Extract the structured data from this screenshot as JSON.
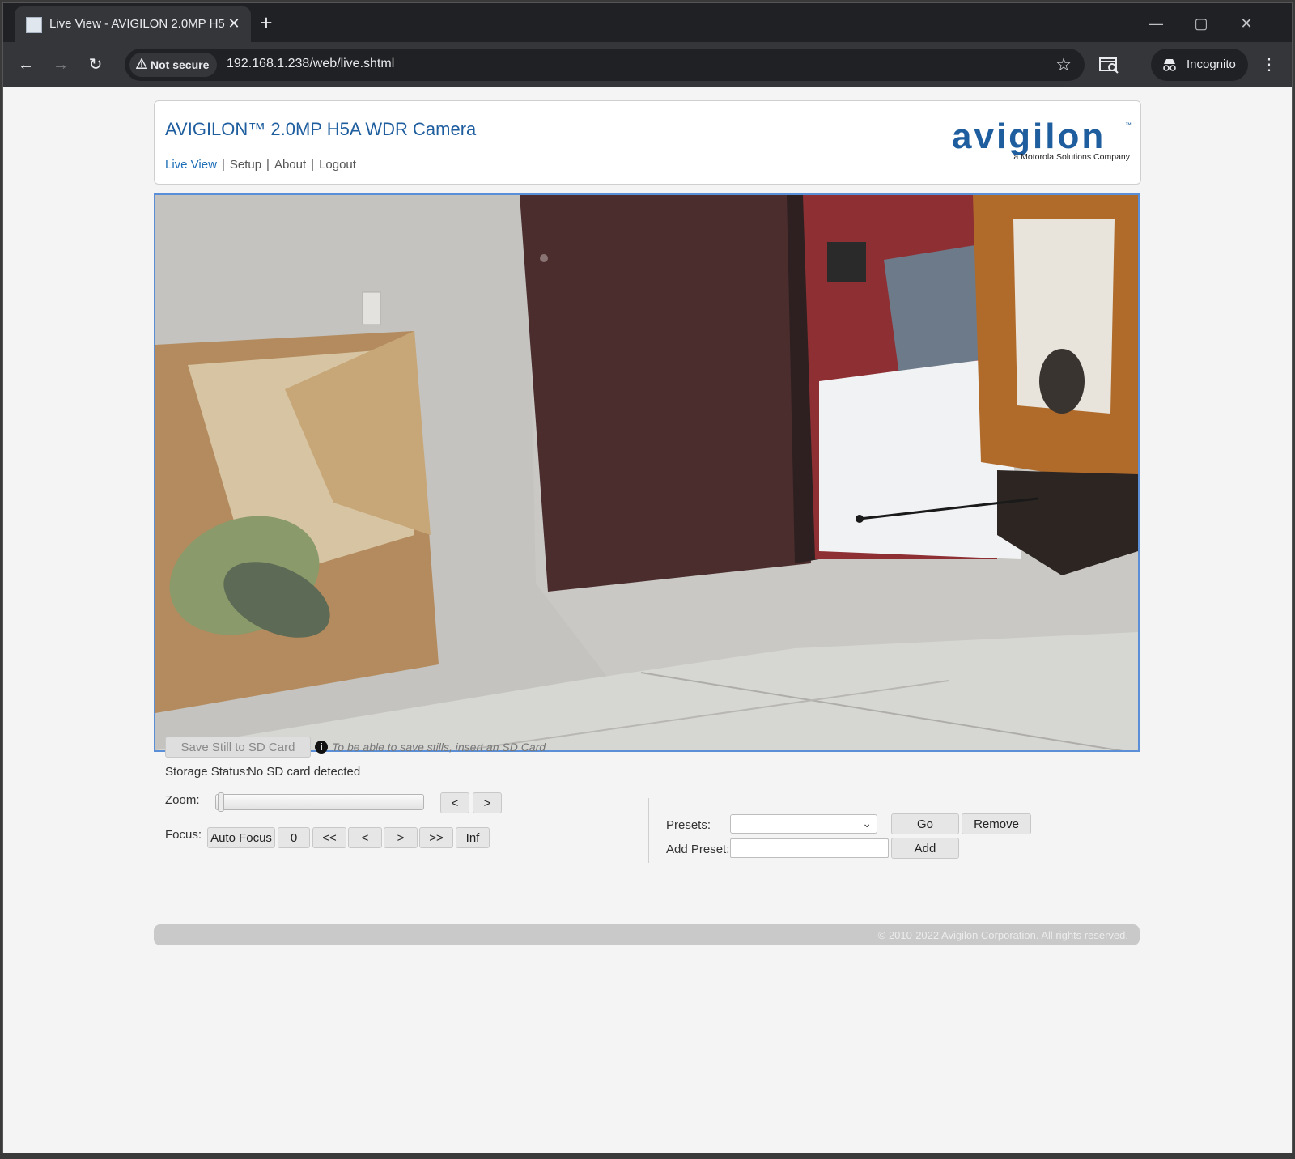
{
  "browser": {
    "tab_title": "Live View - AVIGILON 2.0MP H5",
    "security_label": "Not secure",
    "url": "192.168.1.238/web/live.shtml",
    "profile_label": "Incognito"
  },
  "header": {
    "camera_title": "AVIGILON™ 2.0MP H5A WDR Camera",
    "nav": [
      {
        "label": "Live View",
        "active": true
      },
      {
        "label": "Setup",
        "active": false
      },
      {
        "label": "About",
        "active": false
      },
      {
        "label": "Logout",
        "active": false
      }
    ],
    "logo_text": "avigilon",
    "logo_tm": "™",
    "logo_tagline": "a Motorola Solutions Company"
  },
  "storage": {
    "save_still_label": "Save Still to SD Card",
    "hint": "To be able to save stills, insert an SD Card",
    "status_label": "Storage Status:",
    "status_value": "No SD card detected"
  },
  "zoom": {
    "label": "Zoom:",
    "level": 0,
    "prev_label": "<",
    "next_label": ">"
  },
  "focus": {
    "label": "Focus:",
    "buttons": [
      "Auto Focus",
      "0",
      "<<",
      "<",
      ">",
      ">>",
      "Inf"
    ]
  },
  "presets": {
    "label": "Presets:",
    "selected": "",
    "go_label": "Go",
    "remove_label": "Remove",
    "add_preset_label": "Add Preset:",
    "add_preset_value": "",
    "add_label": "Add"
  },
  "footer": {
    "copyright": "© 2010-2022 Avigilon Corporation. All rights reserved."
  },
  "colors": {
    "brand_blue": "#1f5e9e",
    "video_border": "#5a8fd8"
  }
}
